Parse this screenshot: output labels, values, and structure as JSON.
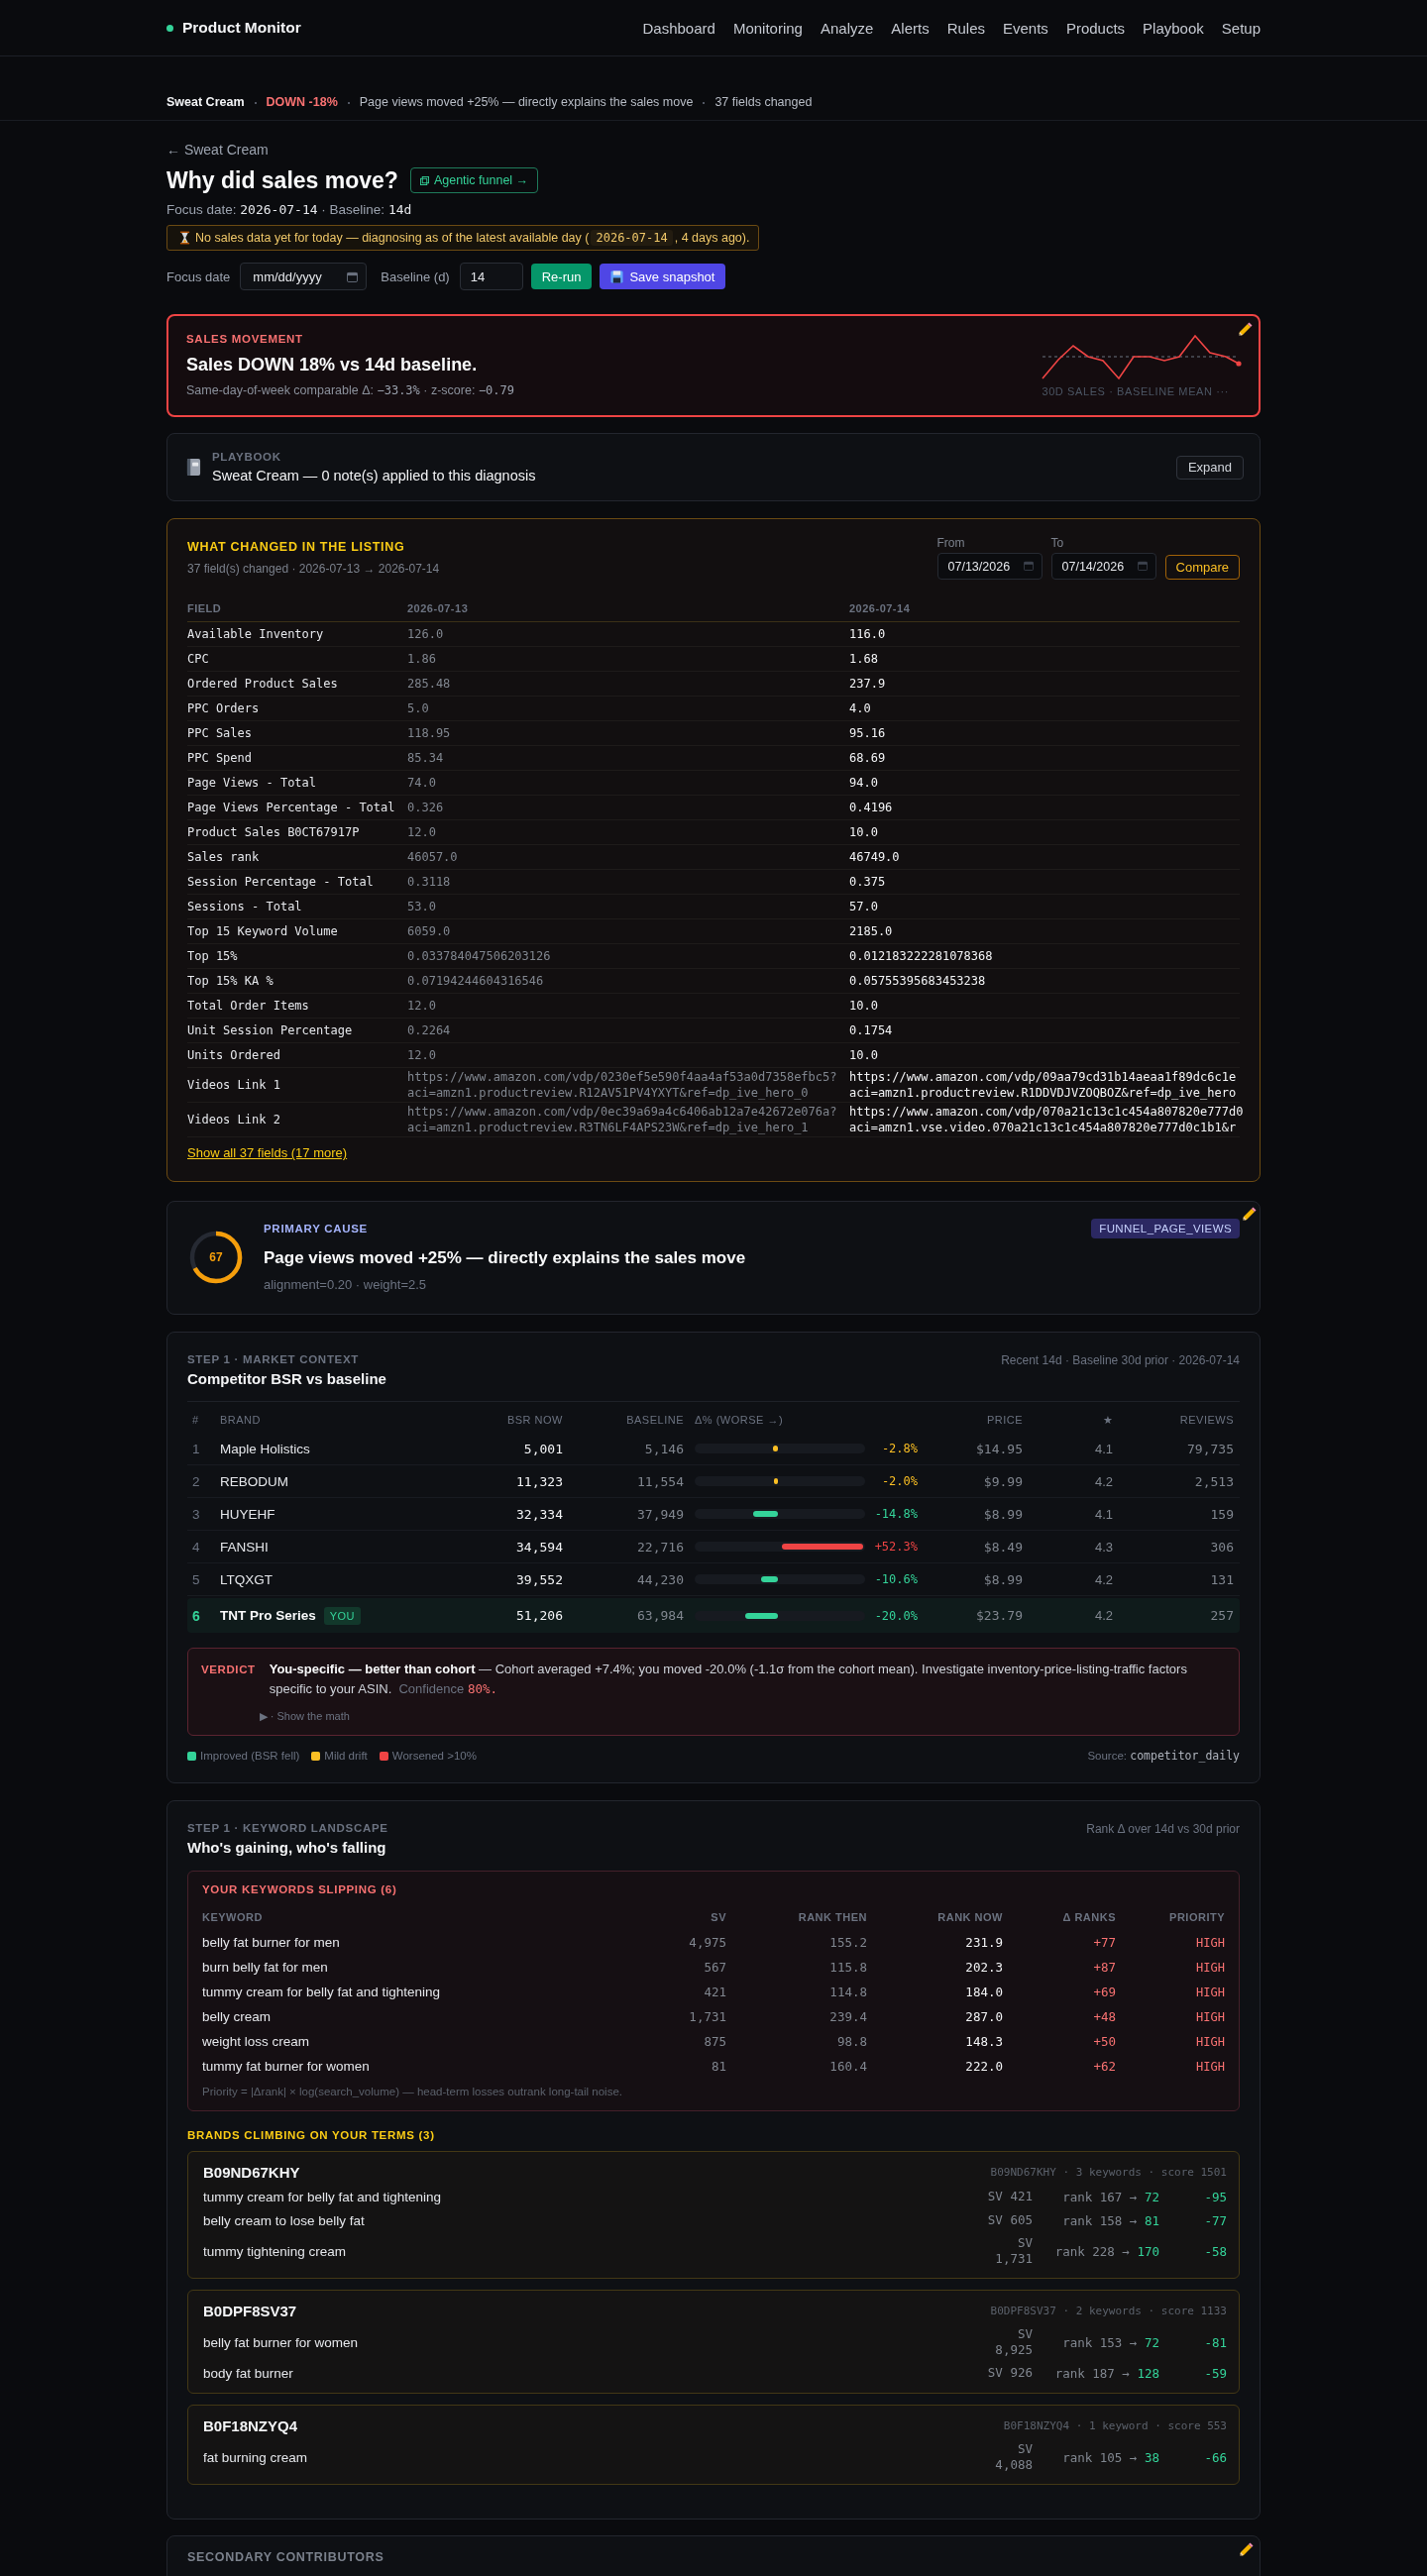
{
  "header": {
    "brand": "Product Monitor",
    "nav": [
      {
        "label": "Dashboard"
      },
      {
        "label": "Monitoring"
      },
      {
        "label": "Analyze"
      },
      {
        "label": "Alerts"
      },
      {
        "label": "Rules"
      },
      {
        "label": "Events"
      },
      {
        "label": "Products"
      },
      {
        "label": "Playbook"
      },
      {
        "label": "Setup"
      }
    ]
  },
  "summary_bar": {
    "items": [
      {
        "text": "Sweat Cream",
        "kind": "product"
      },
      {
        "text": "DOWN -18%",
        "kind": "movement"
      },
      {
        "text": "Page views moved +25% — directly explains the sales move",
        "kind": "cause"
      },
      {
        "text": "37 fields changed",
        "kind": "count"
      }
    ]
  },
  "page": {
    "back_link": "← Sweat Cream",
    "title": "Why did sales move?",
    "funnel_link": "Agentic funnel →",
    "focus_info": [
      {
        "text": "Focus date: ",
        "kind": "text"
      },
      {
        "text": "2026-07-14",
        "kind": "code"
      },
      {
        "text": " · Baseline: ",
        "kind": "text"
      },
      {
        "text": "14d",
        "kind": "code"
      }
    ],
    "notice": [
      {
        "text": "No sales data yet for today — diagnosing as of the latest available day (",
        "kind": "text"
      },
      {
        "text": "2026-07-14",
        "kind": "chip"
      },
      {
        "text": ", 4 days ago).",
        "kind": "text"
      }
    ]
  },
  "controls": {
    "fields": [
      {
        "label": "Focus date",
        "placeholder": "mm/dd/yyyy",
        "kind": "date"
      },
      {
        "label": "Baseline (d)",
        "value": "14",
        "kind": "number"
      }
    ],
    "buttons": [
      {
        "label": "Re-run",
        "kind": "primary"
      },
      {
        "label": "Save snapshot",
        "kind": "save"
      }
    ]
  },
  "sales_movement": {
    "alert": true,
    "label": "SALES MOVEMENT",
    "headline": "Sales DOWN 18% vs 14d baseline.",
    "detail": [
      {
        "text": "Same-day-of-week comparable Δ: ",
        "kind": "text"
      },
      {
        "text": "−33.3%",
        "kind": "code"
      },
      {
        "text": " · z-score: ",
        "kind": "text"
      },
      {
        "text": "−0.79",
        "kind": "code"
      }
    ],
    "chart_caption": "30D SALES · BASELINE MEAN ···"
  },
  "playbook": {
    "label": "PLAYBOOK",
    "text": "Sweat Cream — 0 note(s) applied to this diagnosis",
    "button": "Expand"
  },
  "listing_changes": {
    "title": "WHAT CHANGED IN THE LISTING",
    "subtitle": "37 field(s) changed · 2026-07-13 → 2026-07-14",
    "range": [
      {
        "label": "From",
        "value": "07/13/2026"
      },
      {
        "label": "To",
        "value": "07/14/2026"
      }
    ],
    "button": "Compare",
    "columns": [
      "FIELD",
      "2026-07-13",
      "2026-07-14"
    ],
    "rows": [
      {
        "kind": "value",
        "field": "Available Inventory",
        "old": "126.0",
        "new": "116.0"
      },
      {
        "kind": "value",
        "field": "CPC",
        "old": "1.86",
        "new": "1.68"
      },
      {
        "kind": "value",
        "field": "Ordered Product Sales",
        "old": "285.48",
        "new": "237.9"
      },
      {
        "kind": "value",
        "field": "PPC Orders",
        "old": "5.0",
        "new": "4.0"
      },
      {
        "kind": "value",
        "field": "PPC Sales",
        "old": "118.95",
        "new": "95.16"
      },
      {
        "kind": "value",
        "field": "PPC Spend",
        "old": "85.34",
        "new": "68.69"
      },
      {
        "kind": "value",
        "field": "Page Views - Total",
        "old": "74.0",
        "new": "94.0"
      },
      {
        "kind": "value",
        "field": "Page Views Percentage - Total",
        "old": "0.326",
        "new": "0.4196"
      },
      {
        "kind": "value",
        "field": "Product Sales B0CT67917P",
        "old": "12.0",
        "new": "10.0"
      },
      {
        "kind": "value",
        "field": "Sales rank",
        "old": "46057.0",
        "new": "46749.0"
      },
      {
        "kind": "value",
        "field": "Session Percentage - Total",
        "old": "0.3118",
        "new": "0.375"
      },
      {
        "kind": "value",
        "field": "Sessions - Total",
        "old": "53.0",
        "new": "57.0"
      },
      {
        "kind": "value",
        "field": "Top 15 Keyword Volume",
        "old": "6059.0",
        "new": "2185.0"
      },
      {
        "kind": "value",
        "field": "Top 15%",
        "old": "0.033784047506203126",
        "new": "0.012183222281078368"
      },
      {
        "kind": "value",
        "field": "Top 15% KA %",
        "old": "0.07194244604316546",
        "new": "0.05755395683453238"
      },
      {
        "kind": "value",
        "field": "Total Order Items",
        "old": "12.0",
        "new": "10.0"
      },
      {
        "kind": "value",
        "field": "Unit Session Percentage",
        "old": "0.2264",
        "new": "0.1754"
      },
      {
        "kind": "value",
        "field": "Units Ordered",
        "old": "12.0",
        "new": "10.0"
      },
      {
        "kind": "link",
        "field": "Videos Link 1",
        "old": [
          "https://www.amazon.com/vdp/0230ef5e590f4aa4af53a0d7358efbc5?",
          "aci=amzn1.productreview.R12AV51PV4YXYT&ref=dp_ive_hero_0"
        ],
        "new": [
          "https://www.amazon.com/vdp/09aa79cd31b14aeaa1f89dc6c1e",
          "aci=amzn1.productreview.R1DDVDJVZOQBOZ&ref=dp_ive_hero"
        ]
      },
      {
        "kind": "link",
        "field": "Videos Link 2",
        "old": [
          "https://www.amazon.com/vdp/0ec39a69a4c6406ab12a7e42672e076a?",
          "aci=amzn1.productreview.R3TN6LF4APS23W&ref=dp_ive_hero_1"
        ],
        "new": [
          "https://www.amazon.com/vdp/070a21c13c1c454a807820e777d0",
          "aci=amzn1.vse.video.070a21c13c1c454a807820e777d0c1b1&r"
        ]
      }
    ],
    "more_link": "Show all 37 fields (17 more)"
  },
  "primary_cause": {
    "score": "67",
    "level": 0.67,
    "label": "PRIMARY CAUSE",
    "title": "Page views moved +25% — directly explains the sales move",
    "meta": "alignment=0.20 · weight=2.5",
    "tag": "FUNNEL_PAGE_VIEWS"
  },
  "market_context": {
    "step": "STEP 1 · MARKET CONTEXT",
    "title": "Competitor BSR vs baseline",
    "meta": "Recent 14d · Baseline 30d prior · 2026-07-14",
    "columns": [
      "#",
      "BRAND",
      "BSR NOW",
      "BASELINE",
      "Δ% (WORSE →)",
      "PRICE",
      "★",
      "REVIEWS"
    ],
    "rows": [
      {
        "rank": "1",
        "brand": "Maple Holistics",
        "bsr_now": "5,001",
        "baseline": "5,146",
        "worse": false,
        "level": 0.06,
        "color": "#fbbf24",
        "delta": "-2.8%",
        "price": "$14.95",
        "rating": "4.1",
        "reviews": "79,735",
        "you": false
      },
      {
        "rank": "2",
        "brand": "REBODUM",
        "bsr_now": "11,323",
        "baseline": "11,554",
        "worse": false,
        "level": 0.04,
        "color": "#fbbf24",
        "delta": "-2.0%",
        "price": "$9.99",
        "rating": "4.2",
        "reviews": "2,513",
        "you": false
      },
      {
        "rank": "3",
        "brand": "HUYEHF",
        "bsr_now": "32,334",
        "baseline": "37,949",
        "worse": false,
        "level": 0.3,
        "color": "#34d399",
        "delta": "-14.8%",
        "price": "$8.99",
        "rating": "4.1",
        "reviews": "159",
        "you": false
      },
      {
        "rank": "4",
        "brand": "FANSHI",
        "bsr_now": "34,594",
        "baseline": "22,716",
        "worse": true,
        "level": 1,
        "color": "#ef4444",
        "delta": "+52.3%",
        "price": "$8.49",
        "rating": "4.3",
        "reviews": "306",
        "you": false
      },
      {
        "rank": "5",
        "brand": "LTQXGT",
        "bsr_now": "39,552",
        "baseline": "44,230",
        "worse": false,
        "level": 0.21,
        "color": "#34d399",
        "delta": "-10.6%",
        "price": "$8.99",
        "rating": "4.2",
        "reviews": "131",
        "you": false
      },
      {
        "rank": "6",
        "brand": "TNT Pro Series",
        "tag": "YOU",
        "bsr_now": "51,206",
        "baseline": "63,984",
        "worse": false,
        "level": 0.4,
        "color": "#34d399",
        "delta": "-20.0%",
        "price": "$23.79",
        "rating": "4.2",
        "reviews": "257",
        "you": true
      }
    ],
    "verdict": {
      "label": "VERDICT",
      "text": "**You-specific — better than cohort** — Cohort averaged +7.4%; you moved -20.0% (-1.1σ from the cohort mean). Investigate inventory-price-listing-traffic factors specific to your ASIN.",
      "confidence_label": "Confidence",
      "confidence": "80%.",
      "toggle": "▶ · Show the math"
    },
    "legend": [
      {
        "label": "Improved (BSR fell)",
        "color": "#34d399"
      },
      {
        "label": "Mild drift",
        "color": "#fbbf24"
      },
      {
        "label": "Worsened >10%",
        "color": "#ef4444"
      }
    ],
    "source": [
      {
        "text": "Source: ",
        "kind": "text"
      },
      {
        "text": "competitor_daily",
        "kind": "code"
      }
    ]
  },
  "keyword_landscape": {
    "step": "STEP 1 · KEYWORD LANDSCAPE",
    "title": "Who's gaining, who's falling",
    "meta": "Rank Δ over 14d vs 30d prior",
    "slipping": {
      "title": "YOUR KEYWORDS SLIPPING (6)",
      "columns": [
        "KEYWORD",
        "SV",
        "RANK THEN",
        "RANK NOW",
        "Δ RANKS",
        "PRIORITY"
      ],
      "rows": [
        {
          "keyword": "belly fat burner for men",
          "sv": "4,975",
          "rank_then": "155.2",
          "rank_now": "231.9",
          "delta": "+77",
          "priority": "HIGH"
        },
        {
          "keyword": "burn belly fat for men",
          "sv": "567",
          "rank_then": "115.8",
          "rank_now": "202.3",
          "delta": "+87",
          "priority": "HIGH"
        },
        {
          "keyword": "tummy cream for belly fat and tightening",
          "sv": "421",
          "rank_then": "114.8",
          "rank_now": "184.0",
          "delta": "+69",
          "priority": "HIGH"
        },
        {
          "keyword": "belly cream",
          "sv": "1,731",
          "rank_then": "239.4",
          "rank_now": "287.0",
          "delta": "+48",
          "priority": "HIGH"
        },
        {
          "keyword": "weight loss cream",
          "sv": "875",
          "rank_then": "98.8",
          "rank_now": "148.3",
          "delta": "+50",
          "priority": "HIGH"
        },
        {
          "keyword": "tummy fat burner for women",
          "sv": "81",
          "rank_then": "160.4",
          "rank_now": "222.0",
          "delta": "+62",
          "priority": "HIGH"
        }
      ],
      "note": "Priority = |Δrank| × log(search_volume) — head-term losses outrank long-tail noise."
    },
    "climbing": {
      "title": "BRANDS CLIMBING ON YOUR TERMS (3)",
      "brands": [
        {
          "name": "B09ND67KHY",
          "meta": "B09ND67KHY · 3 keywords · score 1501",
          "keywords": [
            {
              "keyword": "tummy cream for belly fat and tightening",
              "sv": "SV 421",
              "rank": "rank 167 →",
              "rank_now": "72",
              "delta": "-95"
            },
            {
              "keyword": "belly cream to lose belly fat",
              "sv": "SV 605",
              "rank": "rank 158 →",
              "rank_now": "81",
              "delta": "-77"
            },
            {
              "keyword": "tummy tightening cream",
              "sv": "SV 1,731",
              "rank": "rank 228 →",
              "rank_now": "170",
              "delta": "-58"
            }
          ]
        },
        {
          "name": "B0DPF8SV37",
          "meta": "B0DPF8SV37 · 2 keywords · score 1133",
          "keywords": [
            {
              "keyword": "belly fat burner for women",
              "sv": "SV 8,925",
              "rank": "rank 153 →",
              "rank_now": "72",
              "delta": "-81"
            },
            {
              "keyword": "body fat burner",
              "sv": "SV 926",
              "rank": "rank 187 →",
              "rank_now": "128",
              "delta": "-59"
            }
          ]
        },
        {
          "name": "B0F18NZYQ4",
          "meta": "B0F18NZYQ4 · 1 keyword · score 553",
          "keywords": [
            {
              "keyword": "fat burning cream",
              "sv": "SV 4,088",
              "rank": "rank 105 →",
              "rank_now": "38",
              "delta": "-66"
            }
          ]
        }
      ]
    }
  },
  "secondary": {
    "label": "SECONDARY CONTRIBUTORS"
  }
}
